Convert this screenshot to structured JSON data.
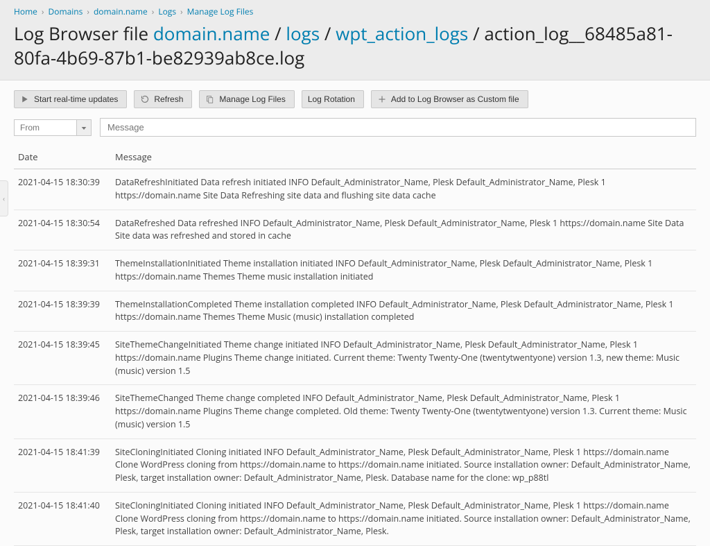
{
  "breadcrumbs": [
    {
      "label": "Home"
    },
    {
      "label": "Domains"
    },
    {
      "label": "domain.name"
    },
    {
      "label": "Logs"
    },
    {
      "label": "Manage Log Files"
    }
  ],
  "title_prefix": "Log Browser file ",
  "title_path": [
    {
      "text": "domain.name",
      "link": true
    },
    {
      "text": " / ",
      "link": false
    },
    {
      "text": "logs",
      "link": true
    },
    {
      "text": " / ",
      "link": false
    },
    {
      "text": "wpt_action_logs",
      "link": true
    },
    {
      "text": " / ",
      "link": false
    },
    {
      "text": "action_log__68485a81-80fa-4b69-87b1-be82939ab8ce.log",
      "link": false
    }
  ],
  "toolbar": {
    "start_updates": "Start real-time updates",
    "refresh": "Refresh",
    "manage_log_files": "Manage Log Files",
    "log_rotation": "Log Rotation",
    "add_custom": "Add to Log Browser as Custom file"
  },
  "filters": {
    "from_placeholder": "From",
    "message_placeholder": "Message"
  },
  "columns": {
    "date": "Date",
    "message": "Message"
  },
  "rows": [
    {
      "date": "2021-04-15 18:30:39",
      "message": "DataRefreshInitiated Data refresh initiated INFO Default_Administrator_Name, Plesk Default_Administrator_Name, Plesk 1 https://domain.name Site Data Refreshing site data and flushing site data cache"
    },
    {
      "date": "2021-04-15 18:30:54",
      "message": "DataRefreshed Data refreshed INFO Default_Administrator_Name, Plesk Default_Administrator_Name, Plesk 1 https://domain.name Site Data Site data was refreshed and stored in cache"
    },
    {
      "date": "2021-04-15 18:39:31",
      "message": "ThemeInstallationInitiated Theme installation initiated INFO Default_Administrator_Name, Plesk Default_Administrator_Name, Plesk 1 https://domain.name Themes Theme music installation initiated"
    },
    {
      "date": "2021-04-15 18:39:39",
      "message": "ThemeInstallationCompleted Theme installation completed INFO Default_Administrator_Name, Plesk Default_Administrator_Name, Plesk 1 https://domain.name Themes Theme Music (music) installation completed"
    },
    {
      "date": "2021-04-15 18:39:45",
      "message": "SiteThemeChangeInitiated Theme change initiated INFO Default_Administrator_Name, Plesk Default_Administrator_Name, Plesk 1 https://domain.name Plugins Theme change initiated. Current theme: Twenty Twenty-One (twentytwentyone) version 1.3, new theme: Music (music) version 1.5"
    },
    {
      "date": "2021-04-15 18:39:46",
      "message": "SiteThemeChanged Theme change completed INFO Default_Administrator_Name, Plesk Default_Administrator_Name, Plesk 1 https://domain.name Plugins Theme change completed. Old theme: Twenty Twenty-One (twentytwentyone) version 1.3. Current theme: Music (music) version 1.5"
    },
    {
      "date": "2021-04-15 18:41:39",
      "message": "SiteCloningInitiated Cloning initiated INFO Default_Administrator_Name, Plesk Default_Administrator_Name, Plesk 1 https://domain.name Clone WordPress cloning from https://domain.name to https://domain.name initiated. Source installation owner: Default_Administrator_Name, Plesk, target installation owner: Default_Administrator_Name, Plesk. Database name for the clone: wp_p88tl"
    },
    {
      "date": "2021-04-15 18:41:40",
      "message": "SiteCloningInitiated Cloning initiated INFO Default_Administrator_Name, Plesk Default_Administrator_Name, Plesk 1 https://domain.name Clone WordPress cloning from https://domain.name to https://domain.name initiated. Source installation owner: Default_Administrator_Name, Plesk, target installation owner: Default_Administrator_Name, Plesk."
    }
  ]
}
